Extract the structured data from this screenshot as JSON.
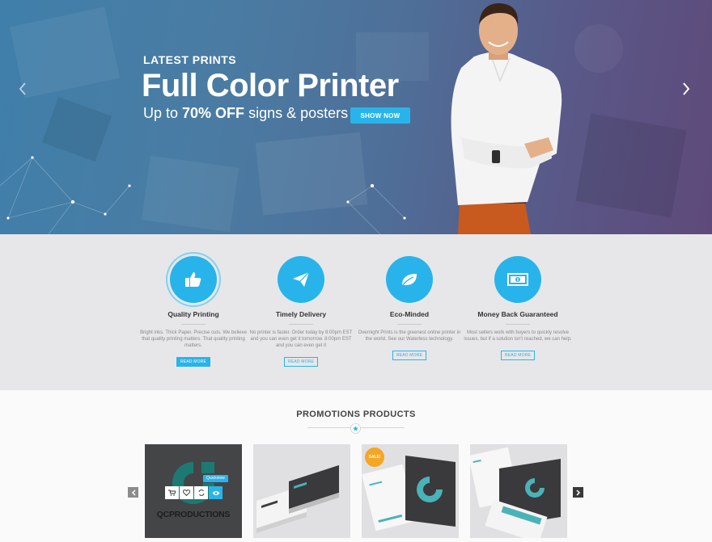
{
  "hero": {
    "kicker": "LATEST PRINTS",
    "title": "Full Color Printer",
    "subtitle_prefix": "Up to ",
    "subtitle_highlight": "70% OFF",
    "subtitle_suffix": " signs & posters",
    "cta": "SHOW NOW"
  },
  "features": [
    {
      "icon": "thumbs-up-icon",
      "title": "Quality Printing",
      "desc": "Bright inks. Thick Paper. Precise cuts. We believe that quality printing matters.  That quality printing matters.",
      "button": "READ MORE"
    },
    {
      "icon": "paper-plane-icon",
      "title": "Timely Delivery",
      "desc": "No printer is faster. Order today by 8:00pm EST and you can even get it tomorrow. 8:00pm EST and you can even get it",
      "button": "READ MORE"
    },
    {
      "icon": "leaf-icon",
      "title": "Eco-Minded",
      "desc": "Overnight Prints is the greenest online printer in the world. See our Waterless technology.",
      "button": "READ MORE"
    },
    {
      "icon": "money-icon",
      "title": "Money Back Guaranteed",
      "desc": "Most sellers work with buyers to quickly resolve issues, but if a solution isn't reached, we can help.",
      "button": "READ MORE"
    }
  ],
  "promotions": {
    "title": "PROMOTIONS PRODUCTS",
    "quickview": "Quickview",
    "brand": "QCPRODUCTIONS",
    "sale": "SALE!"
  },
  "colors": {
    "accent": "#28b4ea",
    "sale": "#f5a623"
  }
}
